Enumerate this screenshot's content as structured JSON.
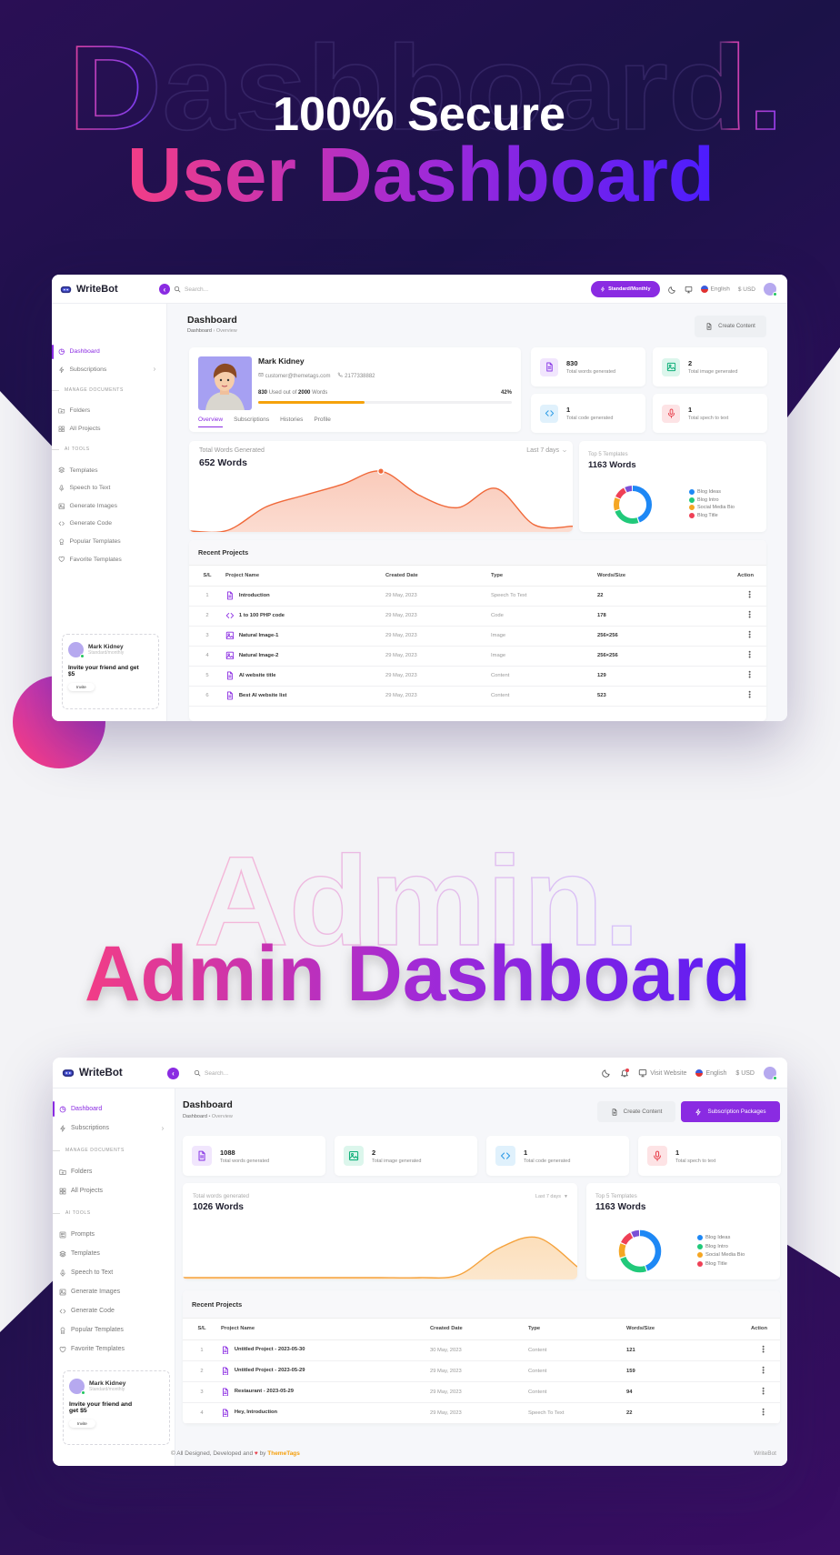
{
  "hero": {
    "outline_word": "Dashboard.",
    "subtitle": "100% Secure",
    "title": "User Dashboard"
  },
  "admin_hero": {
    "outline_word": "Admin.",
    "title": "Admin Dashboard"
  },
  "colors": {
    "brand_purple": "#8a2be2",
    "gradient_start": "#f23d86",
    "gradient_end": "#4b1cff",
    "chart_orange": "#f0693a",
    "chart_amber": "#f5a23c"
  },
  "user_dashboard": {
    "brand": "WriteBot",
    "search_placeholder": "Search...",
    "plan_button": "Standard/Monthly",
    "language": "English",
    "currency": "$ USD",
    "sidebar": [
      {
        "label": "Dashboard",
        "icon": "pie-chart-icon",
        "active": true
      },
      {
        "label": "Subscriptions",
        "icon": "bolt-icon",
        "chevron": true
      },
      {
        "section": "MANAGE DOCUMENTS"
      },
      {
        "label": "Folders",
        "icon": "folder-icon"
      },
      {
        "label": "All Projects",
        "icon": "grid-icon"
      },
      {
        "section": "AI TOOLS"
      },
      {
        "label": "Templates",
        "icon": "layers-icon"
      },
      {
        "label": "Speech to Text",
        "icon": "mic-icon"
      },
      {
        "label": "Generate Images",
        "icon": "image-icon"
      },
      {
        "label": "Generate Code",
        "icon": "code-icon"
      },
      {
        "label": "Popular Templates",
        "icon": "award-icon"
      },
      {
        "label": "Favorite Templates",
        "icon": "heart-icon"
      }
    ],
    "promo": {
      "name": "Mark Kidney",
      "plan": "Standard/monthly",
      "text": "Invite your friend and get $5",
      "button": "Invite"
    },
    "page": {
      "title": "Dashboard",
      "breadcrumb": [
        "Dashboard",
        "Overview"
      ],
      "create_button": "Create Content"
    },
    "profile": {
      "name": "Mark Kidney",
      "email": "customer@themetags.com",
      "phone": "2177338882",
      "used": "830",
      "used_text": "Used out of",
      "total": "2000",
      "unit": "Words",
      "percent_label": "42%",
      "progress": 0.42,
      "tabs": [
        "Overview",
        "Subscriptions",
        "Histories",
        "Profile"
      ],
      "active_tab": 0
    },
    "stats": [
      {
        "value": "830",
        "label": "Total words generated",
        "icon": "document-icon",
        "color": "#8b3ce6",
        "bg": "#f1e6fd"
      },
      {
        "value": "2",
        "label": "Total image generated",
        "icon": "image-icon",
        "color": "#12b07a",
        "bg": "#dcf6ec"
      },
      {
        "value": "1",
        "label": "Total code generated",
        "icon": "code-icon",
        "color": "#2e9be6",
        "bg": "#e0f1fc"
      },
      {
        "value": "1",
        "label": "Total spech to text",
        "icon": "mic-icon",
        "color": "#e8434f",
        "bg": "#fde3e5"
      }
    ],
    "words_chart": {
      "label": "Total Words Generated",
      "value": "652 Words",
      "range": "Last 7 days",
      "trend": [
        0,
        1,
        35,
        52,
        68,
        87,
        52,
        34,
        62,
        9,
        7
      ],
      "highlight_index": 5,
      "color": "#f0693a"
    },
    "templates": {
      "label": "Top 5 Templates",
      "value": "1163 Words",
      "segments": [
        {
          "name": "Blog Ideas",
          "share": 45,
          "color": "#1e88f5"
        },
        {
          "name": "Blog Intro",
          "share": 25,
          "color": "#21c97a"
        },
        {
          "name": "Social Media Bio",
          "share": 12,
          "color": "#f5a623"
        },
        {
          "name": "Blog Title",
          "share": 11,
          "color": "#ef4056"
        },
        {
          "share": 7,
          "color": "#7b4fd6"
        }
      ]
    },
    "projects": {
      "title": "Recent Projects",
      "columns": [
        "S/L",
        "Project Name",
        "Created Date",
        "Type",
        "Words/Size",
        "Action"
      ],
      "rows": [
        {
          "sl": "1",
          "name": "Introduction",
          "icon": "document-icon",
          "date": "29 May, 2023",
          "type": "Speech To Text",
          "size": "22"
        },
        {
          "sl": "2",
          "name": "1 to 100 PHP code",
          "icon": "code-icon",
          "date": "29 May, 2023",
          "type": "Code",
          "size": "178"
        },
        {
          "sl": "3",
          "name": "Natural Image-1",
          "icon": "image-icon",
          "date": "29 May, 2023",
          "type": "Image",
          "size": "256×256"
        },
        {
          "sl": "4",
          "name": "Natural Image-2",
          "icon": "image-icon",
          "date": "29 May, 2023",
          "type": "Image",
          "size": "256×256"
        },
        {
          "sl": "5",
          "name": "AI website title",
          "icon": "document-icon",
          "date": "29 May, 2023",
          "type": "Content",
          "size": "129"
        },
        {
          "sl": "6",
          "name": "Best AI website list",
          "icon": "document-icon",
          "date": "29 May, 2023",
          "type": "Content",
          "size": "523"
        }
      ]
    }
  },
  "admin_dashboard": {
    "brand": "WriteBot",
    "search_placeholder": "Search...",
    "visit_website": "Visit Website",
    "language": "English",
    "currency": "$ USD",
    "sidebar": [
      {
        "label": "Dashboard",
        "icon": "pie-chart-icon",
        "active": true
      },
      {
        "label": "Subscriptions",
        "icon": "bolt-icon",
        "chevron": true
      },
      {
        "section": "MANAGE DOCUMENTS"
      },
      {
        "label": "Folders",
        "icon": "folder-icon"
      },
      {
        "label": "All Projects",
        "icon": "grid-icon"
      },
      {
        "section": "AI TOOLS"
      },
      {
        "label": "Prompts",
        "icon": "prompts-icon"
      },
      {
        "label": "Templates",
        "icon": "layers-icon"
      },
      {
        "label": "Speech to Text",
        "icon": "mic-icon"
      },
      {
        "label": "Generate Images",
        "icon": "image-icon"
      },
      {
        "label": "Generate Code",
        "icon": "code-icon"
      },
      {
        "label": "Popular Templates",
        "icon": "award-icon"
      },
      {
        "label": "Favorite Templates",
        "icon": "heart-icon"
      }
    ],
    "promo": {
      "name": "Mark Kidney",
      "plan": "Standard/monthly",
      "text": "Invite your friend and get $5",
      "button": "Invite"
    },
    "page": {
      "title": "Dashboard",
      "breadcrumb": [
        "Dashboard",
        "Overview"
      ],
      "create_button": "Create Content",
      "packages_button": "Subscription Packages"
    },
    "stats": [
      {
        "value": "1088",
        "label": "Total words generated",
        "icon": "document-icon",
        "color": "#8b3ce6",
        "bg": "#f1e6fd"
      },
      {
        "value": "2",
        "label": "Total image generated",
        "icon": "image-icon",
        "color": "#12b07a",
        "bg": "#dcf6ec"
      },
      {
        "value": "1",
        "label": "Total code generated",
        "icon": "code-icon",
        "color": "#2e9be6",
        "bg": "#e0f1fc"
      },
      {
        "value": "1",
        "label": "Total spech to text",
        "icon": "mic-icon",
        "color": "#e8434f",
        "bg": "#fde3e5"
      }
    ],
    "words_chart": {
      "label": "Total words generated",
      "value": "1026 Words",
      "range": "Last 7 days",
      "trend": [
        0,
        0,
        0,
        0,
        0,
        0,
        0,
        3,
        32,
        44,
        12
      ],
      "color": "#f5a23c"
    },
    "templates": {
      "label": "Top 5 Templates",
      "value": "1163 Words",
      "segments": [
        {
          "name": "Blog Ideas",
          "share": 45,
          "color": "#1e88f5"
        },
        {
          "name": "Blog Intro",
          "share": 25,
          "color": "#21c97a"
        },
        {
          "name": "Social Media Bio",
          "share": 12,
          "color": "#f5a623"
        },
        {
          "name": "Blog Title",
          "share": 11,
          "color": "#ef4056"
        },
        {
          "share": 7,
          "color": "#7b4fd6"
        }
      ]
    },
    "projects": {
      "title": "Recent Projects",
      "columns": [
        "S/L",
        "Project Name",
        "Created Date",
        "Type",
        "Words/Size",
        "Action"
      ],
      "rows": [
        {
          "sl": "1",
          "name": "Untitled Project - 2023-05-30",
          "icon": "document-icon",
          "date": "30 May, 2023",
          "type": "Content",
          "size": "121"
        },
        {
          "sl": "2",
          "name": "Untitled Project - 2023-05-29",
          "icon": "document-icon",
          "date": "29 May, 2023",
          "type": "Content",
          "size": "159"
        },
        {
          "sl": "3",
          "name": "Restaurant - 2023-05-29",
          "icon": "document-icon",
          "date": "29 May, 2023",
          "type": "Content",
          "size": "94"
        },
        {
          "sl": "4",
          "name": "Hey, Introduction",
          "icon": "document-icon",
          "date": "29 May, 2023",
          "type": "Speech To Text",
          "size": "22"
        }
      ]
    },
    "footer": {
      "prefix": "© All Designed, Developed and",
      "by": "by",
      "company": "ThemeTags",
      "right": "WriteBot"
    }
  }
}
